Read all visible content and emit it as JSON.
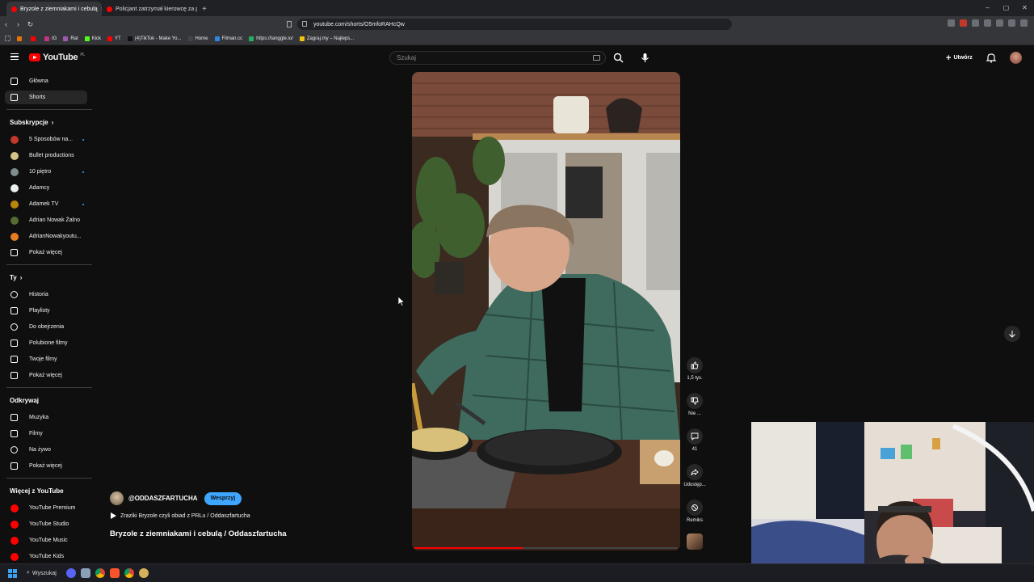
{
  "browser": {
    "tabs": [
      {
        "title": "Bryzole z ziemniakami i cebulą",
        "active": true
      },
      {
        "title": "Policjant zatrzymał kierowcę za prędkość",
        "active": false
      }
    ],
    "new_tab": "+",
    "url": "youtube.com/shorts/O5mfoRAHcQw",
    "window_controls": [
      "–",
      "▢",
      "✕"
    ],
    "bookmarks": [
      "",
      "",
      "IG",
      "Rat",
      "Kick",
      "YT",
      "(4)TikTok - Make Yo...",
      "Home",
      "Filman.cc",
      "https://tanggle.io/",
      "Zagraj.my – Najleps..."
    ]
  },
  "header": {
    "logo_text": "YouTube",
    "logo_region": "PL",
    "search_placeholder": "Szukaj",
    "create_label": "Utwórz"
  },
  "sidebar": {
    "main": [
      {
        "label": "Główna",
        "icon": "home-icon",
        "active": false
      },
      {
        "label": "Shorts",
        "icon": "shorts-icon",
        "active": true
      }
    ],
    "subscriptions_title": "Subskrypcje",
    "subscriptions": [
      {
        "label": "5 Sposobów na...",
        "color": "#c0392b",
        "new": true
      },
      {
        "label": "Bullet productions",
        "color": "#d4c48a",
        "new": false
      },
      {
        "label": "10 piętro",
        "color": "#7f8c8d",
        "new": true
      },
      {
        "label": "Adamcy",
        "color": "#ecf0f1",
        "new": false
      },
      {
        "label": "Adamek TV",
        "color": "#b8860b",
        "new": true
      },
      {
        "label": "Adrian Nowak Żalno",
        "color": "#556b2f",
        "new": false
      },
      {
        "label": "AdrianNowakyoutu...",
        "color": "#e67e22",
        "new": false
      }
    ],
    "show_more": "Pokaż więcej",
    "you_title": "Ty",
    "you": [
      {
        "label": "Historia",
        "icon": "history-icon"
      },
      {
        "label": "Playlisty",
        "icon": "playlists-icon"
      },
      {
        "label": "Do obejrzenia",
        "icon": "watch-later-icon"
      },
      {
        "label": "Polubione filmy",
        "icon": "liked-icon"
      },
      {
        "label": "Twoje filmy",
        "icon": "your-videos-icon"
      }
    ],
    "explore_title": "Odkrywaj",
    "explore": [
      {
        "label": "Muzyka",
        "icon": "music-icon"
      },
      {
        "label": "Filmy",
        "icon": "movies-icon"
      },
      {
        "label": "Na żywo",
        "icon": "live-icon"
      }
    ],
    "more_title": "Więcej z YouTube",
    "more": [
      {
        "label": "YouTube Premium",
        "color": "#ff0000"
      },
      {
        "label": "YouTube Studio",
        "color": "#ff0000"
      },
      {
        "label": "YouTube Music",
        "color": "#ff0000"
      },
      {
        "label": "YouTube Kids",
        "color": "#ff0000"
      }
    ]
  },
  "short": {
    "channel": "@ODDASZFARTUCHA",
    "support_label": "Wesprzyj",
    "playlist": "Zraziki  Bryzole  czyli obiad z PRLu  / Oddaszfartucha",
    "title": "Bryzole z ziemniakami i cebulą / Oddaszfartucha",
    "progress_fraction": 0.41,
    "actions": {
      "likes": "1,5 tys.",
      "dislike": "Nie ...",
      "comments": "41",
      "share": "Udostęp...",
      "remix": "Remiks"
    }
  },
  "taskbar": {
    "search_label": "Wyszukaj"
  }
}
